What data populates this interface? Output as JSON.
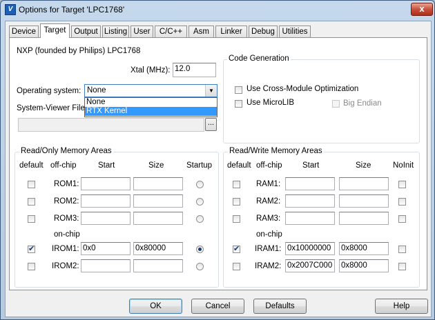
{
  "window": {
    "title": "Options for Target 'LPC1768'",
    "app_icon_glyph": "V",
    "close_glyph": "x"
  },
  "tabs": [
    "Device",
    "Target",
    "Output",
    "Listing",
    "User",
    "C/C++",
    "Asm",
    "Linker",
    "Debug",
    "Utilities"
  ],
  "active_tab": "Target",
  "device_label": "NXP (founded by Philips) LPC1768",
  "xtal": {
    "label": "Xtal (MHz):",
    "value": "12.0"
  },
  "os": {
    "label": "Operating system:",
    "value": "None",
    "options": [
      "None",
      "RTX Kernel"
    ],
    "highlighted": "RTX Kernel"
  },
  "sysviewer": {
    "label": "System-Viewer File (",
    "value": "",
    "browse_label": "..."
  },
  "codegen": {
    "title": "Code Generation",
    "cross_module": {
      "label": "Use Cross-Module Optimization",
      "checked": false
    },
    "microlib": {
      "label": "Use MicroLIB",
      "checked": false
    },
    "big_endian": {
      "label": "Big Endian",
      "checked": false,
      "disabled": true
    }
  },
  "rom": {
    "title": "Read/Only Memory Areas",
    "headers": {
      "default": "default",
      "offchip": "off-chip",
      "start": "Start",
      "size": "Size",
      "extra": "Startup"
    },
    "onchip_label": "on-chip",
    "rows": [
      {
        "name": "ROM1:",
        "default": false,
        "start": "",
        "size": "",
        "extra": false
      },
      {
        "name": "ROM2:",
        "default": false,
        "start": "",
        "size": "",
        "extra": false
      },
      {
        "name": "ROM3:",
        "default": false,
        "start": "",
        "size": "",
        "extra": false
      },
      {
        "name": "IROM1:",
        "default": true,
        "start": "0x0",
        "size": "0x80000",
        "extra": true
      },
      {
        "name": "IROM2:",
        "default": false,
        "start": "",
        "size": "",
        "extra": false
      }
    ]
  },
  "ram": {
    "title": "Read/Write Memory Areas",
    "headers": {
      "default": "default",
      "offchip": "off-chip",
      "start": "Start",
      "size": "Size",
      "extra": "NoInit"
    },
    "onchip_label": "on-chip",
    "rows": [
      {
        "name": "RAM1:",
        "default": false,
        "start": "",
        "size": "",
        "extra": false
      },
      {
        "name": "RAM2:",
        "default": false,
        "start": "",
        "size": "",
        "extra": false
      },
      {
        "name": "RAM3:",
        "default": false,
        "start": "",
        "size": "",
        "extra": false
      },
      {
        "name": "IRAM1:",
        "default": true,
        "start": "0x10000000",
        "size": "0x8000",
        "extra": false
      },
      {
        "name": "IRAM2:",
        "default": false,
        "start": "0x2007C000",
        "size": "0x8000",
        "extra": false
      }
    ]
  },
  "buttons": {
    "ok": "OK",
    "cancel": "Cancel",
    "defaults": "Defaults",
    "help": "Help"
  }
}
